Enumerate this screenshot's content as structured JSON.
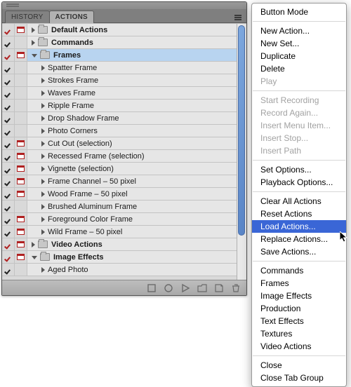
{
  "tabs": {
    "history": "HISTORY",
    "actions": "ACTIONS"
  },
  "sets": {
    "default_actions": "Default Actions",
    "commands": "Commands",
    "frames": "Frames",
    "video_actions": "Video Actions",
    "image_effects": "Image Effects"
  },
  "actions": {
    "spatter": "Spatter Frame",
    "strokes": "Strokes Frame",
    "waves": "Waves Frame",
    "ripple": "Ripple Frame",
    "drop_shadow": "Drop Shadow Frame",
    "photo_corners": "Photo Corners",
    "cut_out": "Cut Out (selection)",
    "recessed": "Recessed Frame (selection)",
    "vignette": "Vignette (selection)",
    "frame_channel": "Frame Channel – 50 pixel",
    "wood": "Wood Frame – 50 pixel",
    "brushed_al": "Brushed Aluminum Frame",
    "fg_color": "Foreground Color Frame",
    "wild": "Wild Frame – 50 pixel",
    "aged_photo": "Aged Photo"
  },
  "menu": {
    "button_mode": "Button Mode",
    "new_action": "New Action...",
    "new_set": "New Set...",
    "duplicate": "Duplicate",
    "delete": "Delete",
    "play": "Play",
    "start_recording": "Start Recording",
    "record_again": "Record Again...",
    "insert_menu_item": "Insert Menu Item...",
    "insert_stop": "Insert Stop...",
    "insert_path": "Insert Path",
    "set_options": "Set Options...",
    "playback_options": "Playback Options...",
    "clear_all": "Clear All Actions",
    "reset": "Reset Actions",
    "load": "Load Actions...",
    "replace": "Replace Actions...",
    "save": "Save Actions...",
    "preset_commands": "Commands",
    "preset_frames": "Frames",
    "preset_image_effects": "Image Effects",
    "preset_production": "Production",
    "preset_text_effects": "Text Effects",
    "preset_textures": "Textures",
    "preset_video_actions": "Video Actions",
    "close": "Close",
    "close_tab_group": "Close Tab Group"
  }
}
